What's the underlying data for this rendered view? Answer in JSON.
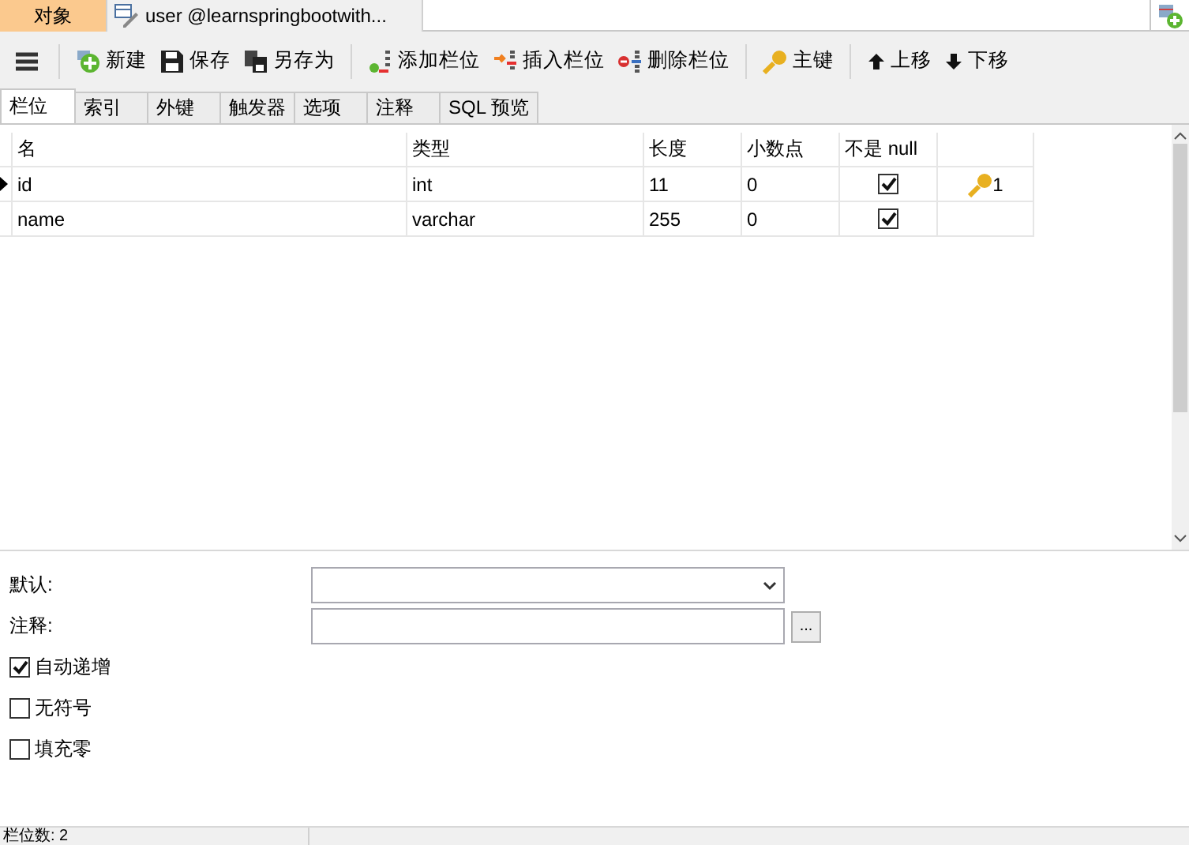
{
  "doc_tabs": [
    {
      "kind": "objects",
      "label": "对象",
      "selected": false
    },
    {
      "kind": "table",
      "label": "user @learnspringbootwith...",
      "selected": true
    }
  ],
  "toolbar": [
    {
      "kind": "new",
      "label": "新建"
    },
    {
      "kind": "save",
      "label": "保存"
    },
    {
      "kind": "saveas",
      "label": "另存为"
    },
    {
      "kind": "addcol",
      "label": "添加栏位"
    },
    {
      "kind": "insertcol",
      "label": "插入栏位"
    },
    {
      "kind": "deletecol",
      "label": "删除栏位"
    },
    {
      "kind": "key",
      "label": "主键"
    },
    {
      "kind": "up",
      "label": "上移"
    },
    {
      "kind": "down",
      "label": "下移"
    }
  ],
  "sub_tabs": [
    {
      "label": "栏位",
      "selected": true
    },
    {
      "label": "索引",
      "selected": false
    },
    {
      "label": "外键",
      "selected": false
    },
    {
      "label": "触发器",
      "selected": false
    },
    {
      "label": "选项",
      "selected": false
    },
    {
      "label": "注释",
      "selected": false
    },
    {
      "label": "SQL 预览",
      "selected": false
    }
  ],
  "table": {
    "columns": [
      "名",
      "类型",
      "长度",
      "小数点",
      "不是 null"
    ],
    "rows": [
      {
        "name": "id",
        "type": "int",
        "length": "11",
        "decimals": "0",
        "not_null": true,
        "key": "1",
        "selected": true
      },
      {
        "name": "name",
        "type": "varchar",
        "length": "255",
        "decimals": "0",
        "not_null": true,
        "selected": false
      }
    ]
  },
  "properties": {
    "fields": [
      {
        "kind": "dropdown",
        "label": "默认:"
      },
      {
        "kind": "text",
        "label": "注释:",
        "button": "..."
      }
    ],
    "options": [
      {
        "label": "自动递增",
        "checked": true
      },
      {
        "label": "无符号",
        "checked": false
      },
      {
        "label": "填充零",
        "checked": false
      }
    ]
  },
  "status_bar": {
    "text": "栏位数: 2"
  }
}
